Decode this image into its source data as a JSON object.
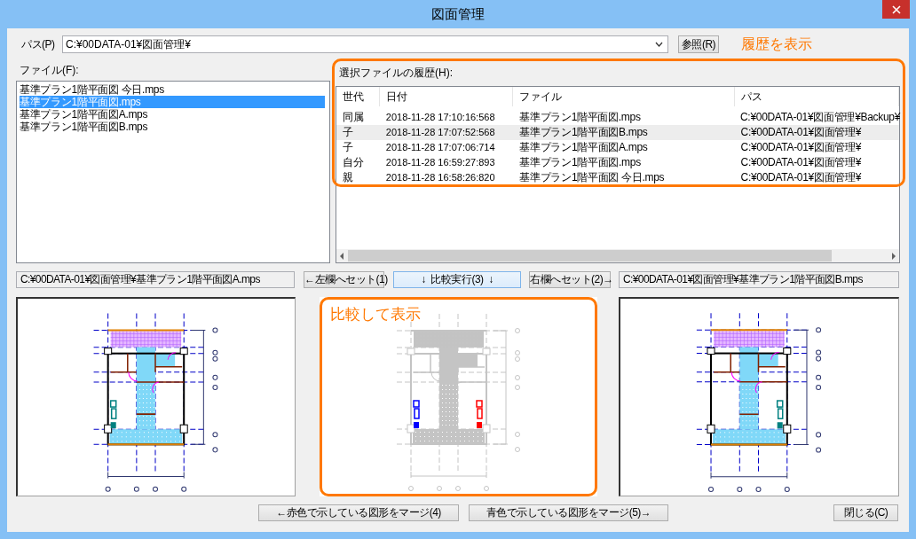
{
  "window": {
    "title": "図面管理"
  },
  "path": {
    "label": "パス(P)",
    "value": "C:¥00DATA-01¥図面管理¥",
    "browse_button": "参照(R)",
    "callout": "履歴を表示"
  },
  "files": {
    "label": "ファイル(F):",
    "items": [
      {
        "name": "基準プラン1階平面図 今日.mps",
        "selected": false
      },
      {
        "name": "基準プラン1階平面図.mps",
        "selected": true
      },
      {
        "name": "基準プラン1階平面図A.mps",
        "selected": false
      },
      {
        "name": "基準プラン1階平面図B.mps",
        "selected": false
      }
    ]
  },
  "history": {
    "label": "選択ファイルの履歴(H):",
    "columns": [
      "世代",
      "日付",
      "ファイル",
      "パス"
    ],
    "rows": [
      {
        "cells": [
          "同属",
          "2018-11-28 17:10:16:568",
          "基準プラン1階平面図.mps",
          "C:¥00DATA-01¥図面管理¥Backup¥"
        ],
        "selected": false
      },
      {
        "cells": [
          "子",
          "2018-11-28 17:07:52:568",
          "基準プラン1階平面図B.mps",
          "C:¥00DATA-01¥図面管理¥"
        ],
        "selected": true
      },
      {
        "cells": [
          "子",
          "2018-11-28 17:07:06:714",
          "基準プラン1階平面図A.mps",
          "C:¥00DATA-01¥図面管理¥"
        ],
        "selected": false
      },
      {
        "cells": [
          "自分",
          "2018-11-28 16:59:27:893",
          "基準プラン1階平面図.mps",
          "C:¥00DATA-01¥図面管理¥"
        ],
        "selected": false
      },
      {
        "cells": [
          "親",
          "2018-11-28 16:58:26:820",
          "基準プラン1階平面図 今日.mps",
          "C:¥00DATA-01¥図面管理¥"
        ],
        "selected": false
      }
    ]
  },
  "compare": {
    "left_path": "C:¥00DATA-01¥図面管理¥基準プラン1階平面図A.mps",
    "set_left_button": "←左欄へセット(1)",
    "run_button": "↓  比較実行(3)  ↓",
    "set_right_button": "右欄へセット(2)→",
    "right_path": "C:¥00DATA-01¥図面管理¥基準プラン1階平面図B.mps"
  },
  "panels": [
    {
      "kind": "plan",
      "mirrored": false
    },
    {
      "kind": "diff",
      "callout": "比較して表示"
    },
    {
      "kind": "plan",
      "mirrored": true
    }
  ],
  "buttons": [
    "←赤色で示している図形をマージ(4)",
    "青色で示している図形をマージ(5)→",
    "閉じる(C)"
  ]
}
